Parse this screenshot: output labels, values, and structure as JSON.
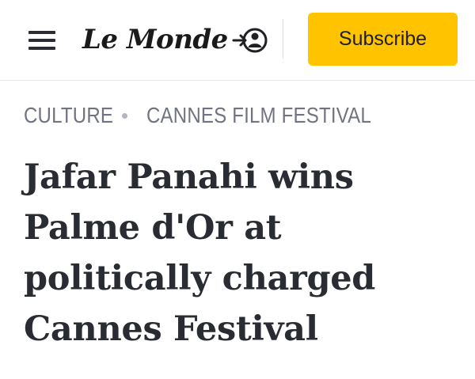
{
  "header": {
    "logo_text": "Le Monde",
    "subscribe_label": "Subscribe",
    "icons": {
      "menu": "hamburger-menu-icon",
      "account": "account-login-icon"
    }
  },
  "breadcrumb": {
    "items": [
      "CULTURE",
      "CANNES FILM FESTIVAL"
    ]
  },
  "article": {
    "headline_lines": [
      "Jafar Panahi wins",
      "Palme d'Or at",
      "politically charged",
      "Cannes Festival"
    ]
  },
  "colors": {
    "subscribe_bg": "#ffc300",
    "headline_text": "#2a2c33",
    "breadcrumb_text": "#707380"
  }
}
